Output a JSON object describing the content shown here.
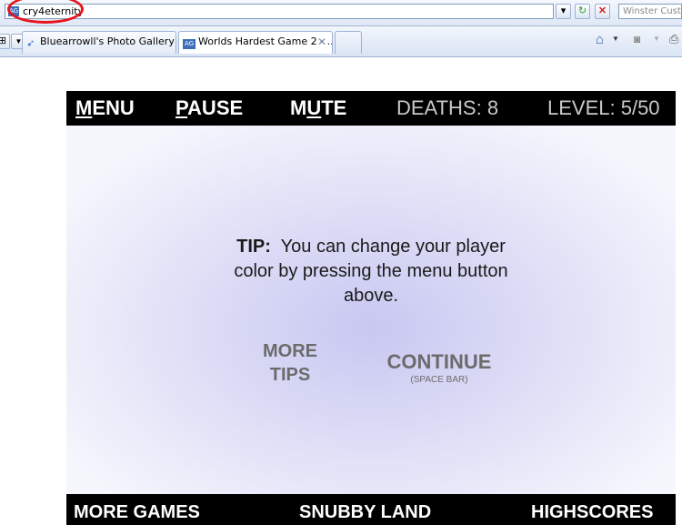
{
  "browser": {
    "url": "cry4eternity",
    "search_placeholder": "Winster Custo",
    "address_icon": "page-icon",
    "tabs": [
      {
        "label": "Bluearrowll's Photo Gallery Fl..."
      },
      {
        "label": "Worlds Hardest Game 2 - ..."
      }
    ],
    "tab_icon_label": "AG",
    "annotation_color": "#e8141d"
  },
  "game": {
    "menu_pre": "",
    "menu_ul": "M",
    "menu_post": "ENU",
    "pause_ul": "P",
    "pause_post": "AUSE",
    "mute_pre": "M",
    "mute_ul": "U",
    "mute_post": "TE",
    "deaths": "DEATHS: 8",
    "level": "LEVEL: 5/50",
    "tip_label": "TIP:",
    "tip_text": "You can change your player color by pressing the menu button above.",
    "more_tips_line1": "MORE",
    "more_tips_line2": "TIPS",
    "continue_label": "CONTINUE",
    "continue_sub": "(SPACE BAR)",
    "more_games": "MORE GAMES",
    "snubby_land": "SNUBBY LAND",
    "highscores": "HIGHSCORES"
  }
}
